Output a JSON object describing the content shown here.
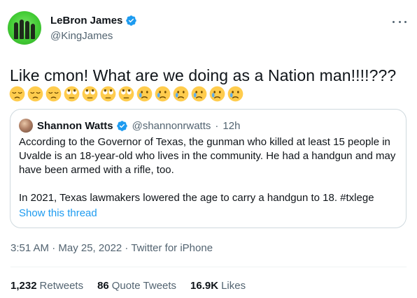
{
  "author": {
    "display_name": "LeBron James",
    "handle": "@KingJames",
    "verified": true
  },
  "tweet": {
    "text": "Like cmon! What are we doing as a Nation man!!!!???",
    "emojis": [
      "pensive-face",
      "pensive-face",
      "pensive-face",
      "face-with-rolling-eyes",
      "face-with-rolling-eyes",
      "face-with-rolling-eyes",
      "face-with-rolling-eyes",
      "crying-face",
      "crying-face",
      "crying-face",
      "crying-face",
      "crying-face",
      "crying-face"
    ]
  },
  "quoted_tweet": {
    "display_name": "Shannon Watts",
    "handle": "@shannonrwatts",
    "separator": "·",
    "time": "12h",
    "paragraph_1": "According to the Governor of Texas, the gunman who killed at least 15 people in Uvalde is an 18-year-old who lives in the community. He had a handgun and may have been armed with a rifle, too.",
    "paragraph_2": "In 2021, Texas lawmakers lowered the age to carry a handgun to 18. #txlege",
    "thread_link": "Show this thread"
  },
  "meta": {
    "text": "3:51 AM · May 25, 2022 · Twitter for iPhone"
  },
  "stats": [
    {
      "value": "1,232",
      "label": "Retweets"
    },
    {
      "value": "86",
      "label": "Quote Tweets"
    },
    {
      "value": "16.9K",
      "label": "Likes"
    }
  ],
  "colors": {
    "link": "#1d9bf0",
    "secondary_text": "#536471",
    "border": "#cfd9de",
    "verified": "#1d9bf0"
  }
}
